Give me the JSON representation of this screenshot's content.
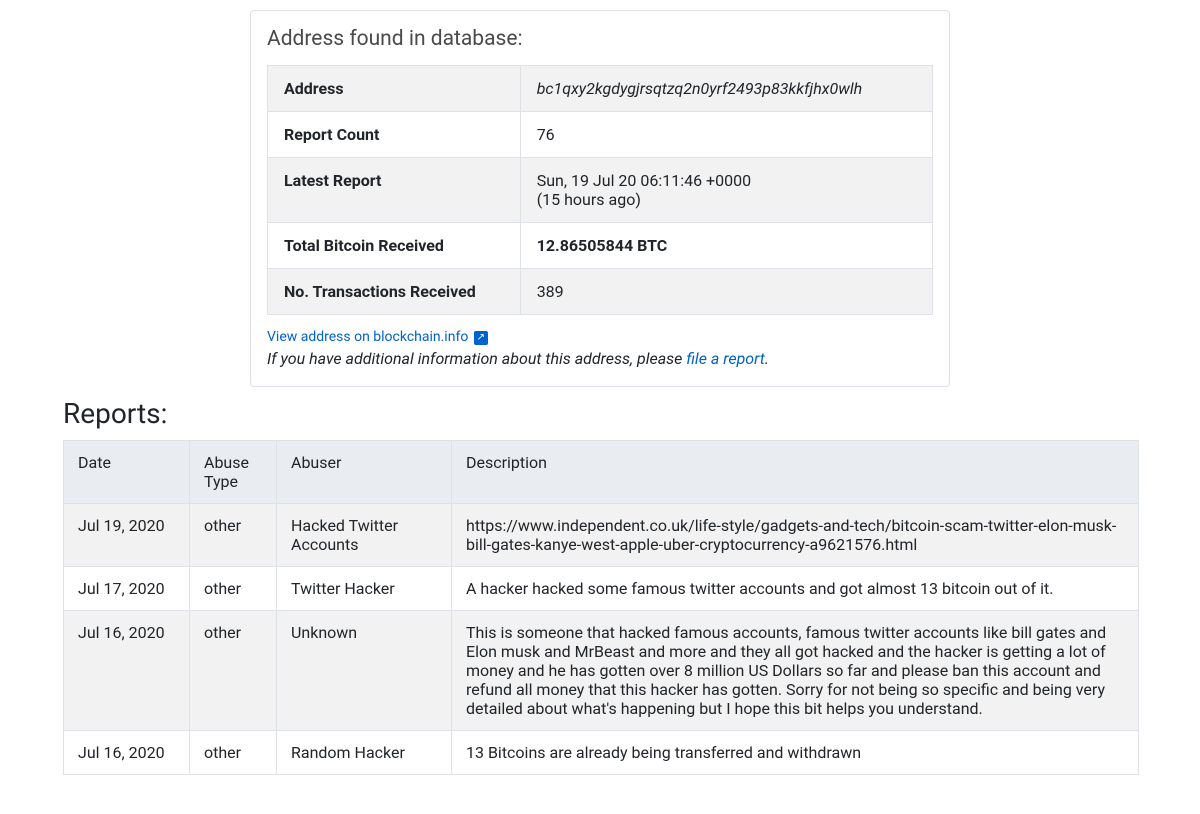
{
  "card": {
    "title": "Address found in database:",
    "rows": [
      {
        "label": "Address",
        "value": "bc1qxy2kgdygjrsqtzq2n0yrf2493p83kkfjhx0wlh",
        "value_italic": true
      },
      {
        "label": "Report Count",
        "value": "76"
      },
      {
        "label": "Latest Report",
        "value": "Sun, 19 Jul 20 06:11:46 +0000",
        "sub": "(15 hours ago)"
      },
      {
        "label": "Total Bitcoin Received",
        "value": "12.86505844 BTC",
        "value_bold": true
      },
      {
        "label": "No. Transactions Received",
        "value": "389"
      }
    ],
    "blockchain_link_text": "View address on blockchain.info",
    "hint_prefix": "If you have additional information about this address, please ",
    "hint_link": "file a report",
    "hint_suffix": "."
  },
  "reports": {
    "heading": "Reports:",
    "columns": [
      "Date",
      "Abuse Type",
      "Abuser",
      "Description"
    ],
    "rows": [
      {
        "date": "Jul 19, 2020",
        "type": "other",
        "abuser": "Hacked Twitter Accounts",
        "description": "https://www.independent.co.uk/life-style/gadgets-and-tech/bitcoin-scam-twitter-elon-musk-bill-gates-kanye-west-apple-uber-cryptocurrency-a9621576.html"
      },
      {
        "date": "Jul 17, 2020",
        "type": "other",
        "abuser": "Twitter Hacker",
        "description": "A hacker hacked some famous twitter accounts and got almost 13 bitcoin out of it."
      },
      {
        "date": "Jul 16, 2020",
        "type": "other",
        "abuser": "Unknown",
        "description": "This is someone that hacked famous accounts, famous twitter accounts like bill gates and Elon musk and MrBeast and more and they all got hacked and the hacker is getting a lot of money and he has gotten over 8 million US Dollars so far and please ban this account and refund all money that this hacker has gotten. Sorry for not being so specific and being very detailed about what's happening but I hope this bit helps you understand."
      },
      {
        "date": "Jul 16, 2020",
        "type": "other",
        "abuser": "Random Hacker",
        "description": "13 Bitcoins are already being transferred and withdrawn"
      }
    ]
  }
}
